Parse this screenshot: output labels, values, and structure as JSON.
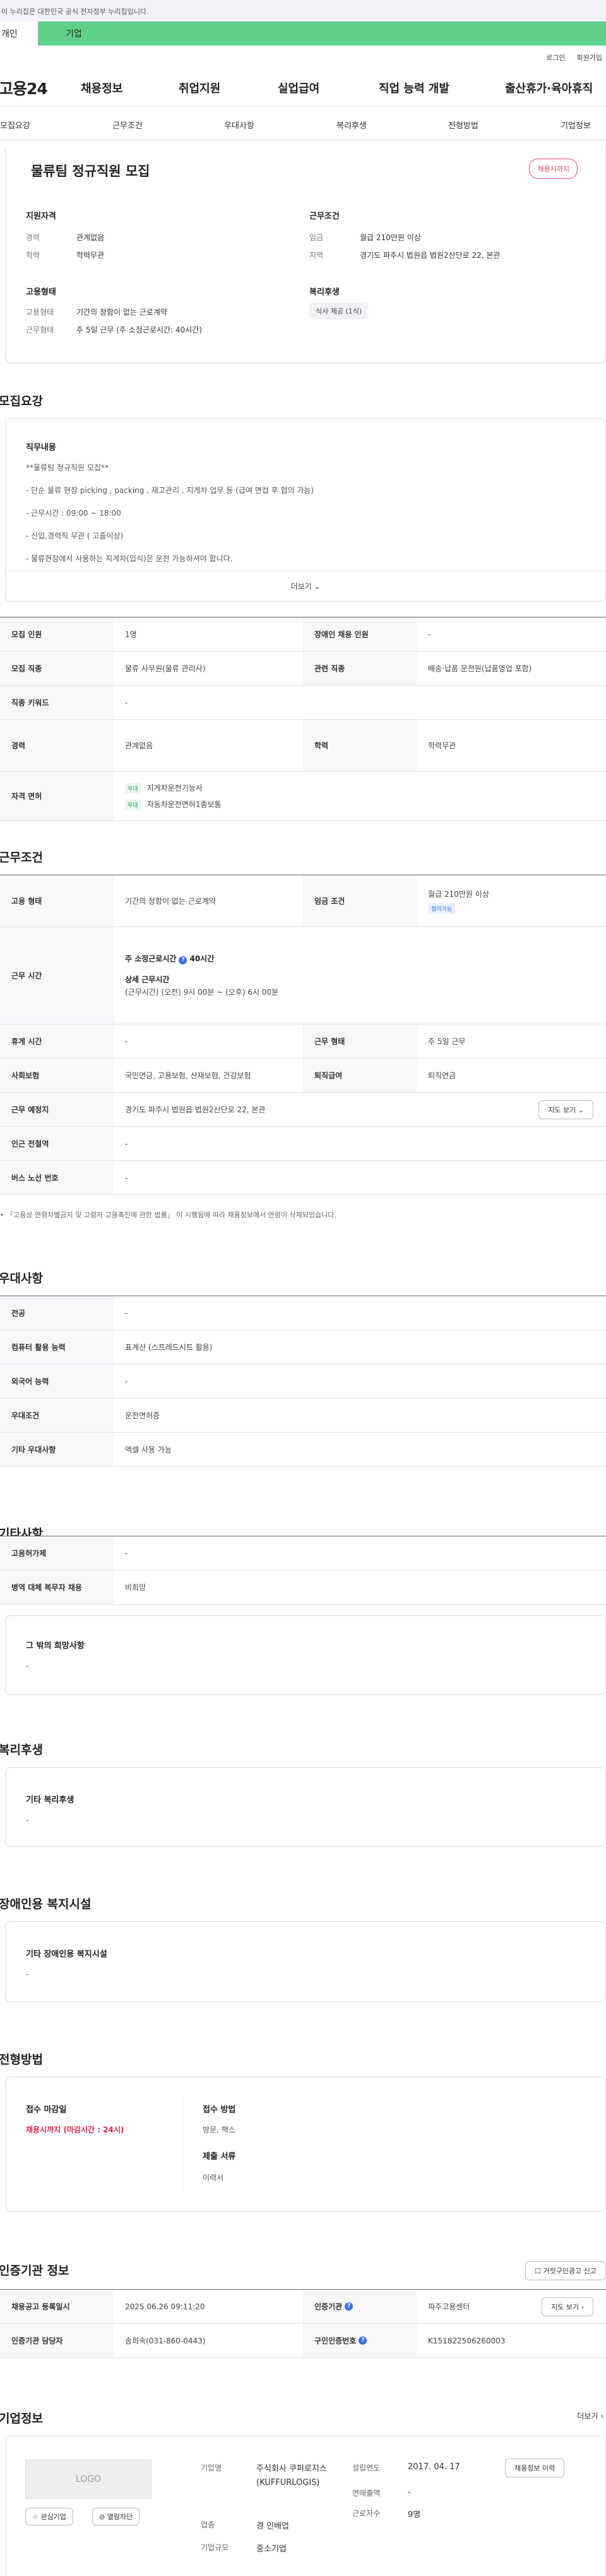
{
  "gov_banner": "이 누리집은 대한민국 공식 전자정부 누리집입니다.",
  "tabs": {
    "personal": "개인",
    "company": "기업"
  },
  "header_links": {
    "login": "로그인",
    "signup": "회원가입"
  },
  "gnb": {
    "logo": "고용24",
    "menu": [
      "채용정보",
      "취업지원",
      "실업급여",
      "직업 능력 개발",
      "출산휴가·육아휴직"
    ]
  },
  "anchor_tabs": [
    "모집요강",
    "근무조건",
    "우대사항",
    "복리후생",
    "전형방법",
    "기업정보"
  ],
  "summary": {
    "title": "물류팀 정규직원 모집",
    "status_badge": "채용시까지",
    "qualification": {
      "heading": "지원자격",
      "career_label": "경력",
      "career_value": "관계없음",
      "edu_label": "학력",
      "edu_value": "학력무관"
    },
    "conditions": {
      "heading": "근무조건",
      "wage_label": "임금",
      "wage_value": "월급 210만원 이상",
      "region_label": "지역",
      "region_value": "경기도 파주시 법원읍 법원2산단로 22, 본관"
    },
    "employment": {
      "heading": "고용형태",
      "type_label": "고용형태",
      "type_value": "기간의 정함이 없는 근로계약",
      "form_label": "근무형태",
      "form_value": "주 5일 근무 (주 소정근로시간: 40시간)"
    },
    "welfare": {
      "heading": "복리후생",
      "chip": "식사 제공 (1식)"
    }
  },
  "recruit": {
    "heading": "모집요강",
    "duty_title": "직무내용",
    "duty_lines": [
      "**물류팀 정규직원 모집**",
      "- 단순 물류 현장 picking , packing , 재고관리 , 지게차 업무 등 (급여 면접 후 협의 가능)",
      "- 근무시간 : 09:00 ~ 18:00",
      "- 신입,경력직 무관 ( 고졸이상)",
      "- 물류현장에서 사용하는 지게차(입식)은 운전 가능하셔야 합니다."
    ],
    "more": "더보기",
    "rows": [
      {
        "k1": "모집 인원",
        "v1": "1명",
        "k2": "장애인 채용 인원",
        "v2": "-"
      },
      {
        "k1": "모집 직종",
        "v1": "물류 사무원(물류 관리사)",
        "k2": "관련 직종",
        "v2": "배송·납품 운전원(납품영업 포함)"
      },
      {
        "k1": "직종 키워드",
        "v1": "-"
      },
      {
        "k1": "경력",
        "v1": "관계없음",
        "k2": "학력",
        "v2": "학력무관"
      }
    ],
    "license_label": "자격 면허",
    "licenses": [
      {
        "badge": "우대",
        "name": "지게차운전기능사"
      },
      {
        "badge": "우대",
        "name": "자동차운전면허1종보통"
      }
    ]
  },
  "work": {
    "heading": "근무조건",
    "employment_label": "고용 형태",
    "employment_value": "기간의 정함이 없는 근로계약",
    "wage_label": "임금 조건",
    "wage_value": "월급 210만원 이상",
    "wage_chip": "협의가능",
    "hours_label": "근무 시간",
    "hours_weekly": "주 소정근로시간",
    "hours_weekly_value": "40시간",
    "hours_detail_title": "상세 근무시간",
    "hours_detail": "(근무시간) (오전) 9시 00분 ~ (오후) 6시 00분",
    "rest_label": "휴게 시간",
    "rest_value": "-",
    "form_label": "근무 형태",
    "form_value": "주 5일 근무",
    "insurance_label": "사회보험",
    "insurance_value": "국민연금, 고용보험, 산재보험, 건강보험",
    "retire_label": "퇴직급여",
    "retire_value": "퇴직연금",
    "place_label": "근무 예정지",
    "place_value": "경기도 파주시 법원읍 법원2산단로 22, 본관",
    "map_btn": "지도 보기",
    "subway_label": "인근 전철역",
    "subway_value": "-",
    "bus_label": "버스 노선 번호",
    "bus_value": "-",
    "note": "「고용상 연령차별금지 및 고령자 고용촉진에 관한 법률」 이 시행됨에 따라 채용정보에서 연령이 삭제되었습니다."
  },
  "preference": {
    "heading": "우대사항",
    "rows": [
      {
        "k": "전공",
        "v": "-"
      },
      {
        "k": "컴퓨터 활용 능력",
        "v": "표계산 (스프레드시트 활용)"
      },
      {
        "k": "외국어 능력",
        "v": "-"
      },
      {
        "k": "우대조건",
        "v": "운전면허증"
      },
      {
        "k": "기타 우대사항",
        "v": "엑셀 사용 가능"
      }
    ]
  },
  "etc": {
    "heading": "기타사항",
    "rows": [
      {
        "k": "고용허가제",
        "v": "-"
      },
      {
        "k": "병역 대체 복무자 채용",
        "v": "비희망"
      }
    ],
    "wish_title": "그 밖의 희망사항",
    "wish_value": "-"
  },
  "benefits": {
    "heading": "복리후생",
    "title": "기타 복리후생",
    "value": "-"
  },
  "facilities": {
    "heading": "장애인용 복지시설",
    "title": "기타 장애인용 복지시설",
    "value": "-"
  },
  "selection": {
    "heading": "전형방법",
    "deadline_title": "접수 마감일",
    "deadline_value": "채용시까지 (마감시간 : 24시)",
    "method_title": "접수 방법",
    "method_value": "방문, 팩스",
    "docs_title": "제출 서류",
    "docs_value": "이력서"
  },
  "cert": {
    "heading": "인증기관 정보",
    "report_btn": "거짓구인광고 신고",
    "reg_label": "채용공고 등록일시",
    "reg_value": "2025.06.26 09:11:20",
    "agency_label": "인증기관",
    "agency_value": "파주고용센터",
    "map_btn": "지도 보기",
    "manager_label": "인증기관 담당자",
    "manager_value": "송희숙(031-860-0443)",
    "cert_no_label": "구인인증번호",
    "cert_no_value": "K151822506260003"
  },
  "company": {
    "heading": "기업정보",
    "more": "더보기",
    "logo": "LOGO",
    "interest_btn": "관심기업",
    "block_btn": "열람차단",
    "name_label": "기업명",
    "name_value": "주식회사 쿠퍼로지스(KUFFURLOGIS)",
    "founded_label": "설립연도",
    "founded_value": "2017. 04. 17",
    "history_btn": "채용정보 이력",
    "sales_label": "연매출액",
    "sales_value": "-",
    "industry_label": "업종",
    "industry_value": "경 인배업",
    "workers_label": "근로자수",
    "workers_value": "9명",
    "size_label": "기업규모",
    "size_value": "중소기업"
  }
}
